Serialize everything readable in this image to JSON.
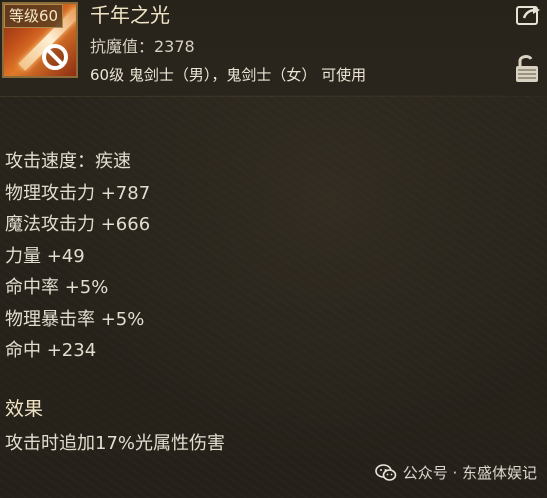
{
  "item": {
    "level_tag": "等级60",
    "name": "千年之光",
    "resist_label": "抗魔值：2378",
    "class_requirement": "60级 鬼剑士（男），鬼剑士（女） 可使用"
  },
  "attributes": [
    "攻击速度：疾速",
    "物理攻击力 +787",
    "魔法攻击力 +666",
    "力量 +49",
    "命中率 +5%",
    "物理暴击率 +5%",
    "命中 +234"
  ],
  "effect": {
    "title": "效果",
    "description": "攻击时追加17%光属性伤害"
  },
  "watermark": {
    "text": "公众号 · 东盛体娱记"
  },
  "icons": {
    "share": "share-icon",
    "lock": "unlock-icon",
    "forbidden": "forbidden-icon",
    "wechat": "wechat-icon"
  },
  "colors": {
    "background": "#27231b",
    "name_text": "#f0e4c4",
    "body_text": "#e3ddcf"
  }
}
